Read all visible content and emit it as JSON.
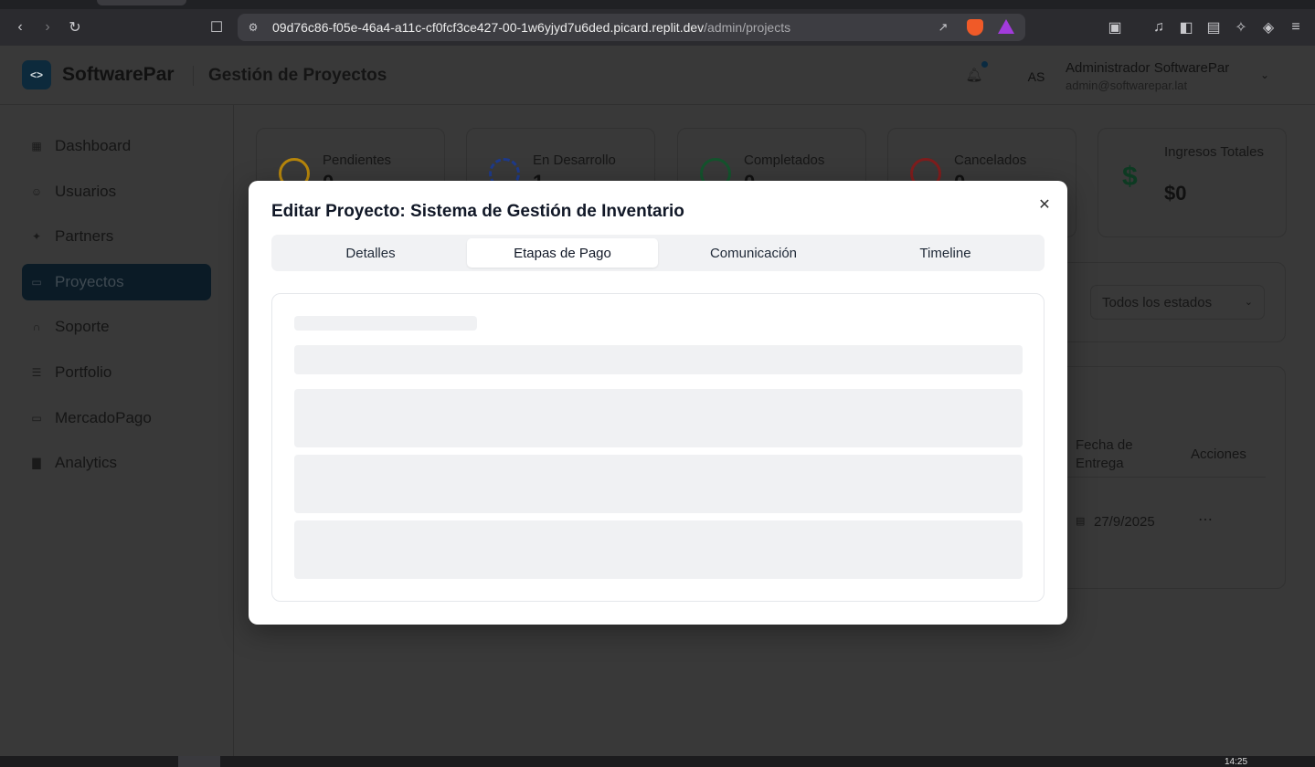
{
  "browser": {
    "url_host": "09d76c86-f05e-46a4-a11c-cf0fcf3ce427-00-1w6yjyd7u6ded.picard.replit.dev",
    "url_path": "/admin/projects"
  },
  "header": {
    "logo_glyph": "<>",
    "brand": "SoftwarePar",
    "page_title": "Gestión de Proyectos",
    "avatar_initials": "AS",
    "user_name": "Administrador SoftwarePar",
    "user_email": "admin@softwarepar.lat"
  },
  "sidebar": {
    "items": [
      {
        "label": "Dashboard",
        "icon": "dashboard-icon"
      },
      {
        "label": "Usuarios",
        "icon": "users-icon"
      },
      {
        "label": "Partners",
        "icon": "handshake-icon"
      },
      {
        "label": "Proyectos",
        "icon": "folder-icon",
        "active": true
      },
      {
        "label": "Soporte",
        "icon": "headset-icon"
      },
      {
        "label": "Portfolio",
        "icon": "document-icon"
      },
      {
        "label": "MercadoPago",
        "icon": "credit-card-icon"
      },
      {
        "label": "Analytics",
        "icon": "bar-chart-icon"
      }
    ]
  },
  "stats": [
    {
      "label": "Pendientes",
      "value": "0",
      "color": "#b7860b"
    },
    {
      "label": "En Desarrollo",
      "value": "1",
      "color": "#1e3a8a"
    },
    {
      "label": "Completados",
      "value": "0",
      "color": "#14532d"
    },
    {
      "label": "Cancelados",
      "value": "0",
      "color": "#7f1d1d"
    },
    {
      "label": "Ingresos Totales",
      "value": "$0",
      "color": "#14532d"
    }
  ],
  "filters": {
    "status_select": "Todos los estados"
  },
  "table": {
    "headers": {
      "delivery_date": "Fecha de Entrega",
      "actions": "Acciones"
    },
    "rows": [
      {
        "delivery_date": "27/9/2025"
      }
    ]
  },
  "modal": {
    "title": "Editar Proyecto: Sistema de Gestión de Inventario",
    "tabs": [
      "Detalles",
      "Etapas de Pago",
      "Comunicación",
      "Timeline"
    ],
    "active_tab": "Etapas de Pago"
  },
  "taskbar": {
    "time": "14:25"
  }
}
